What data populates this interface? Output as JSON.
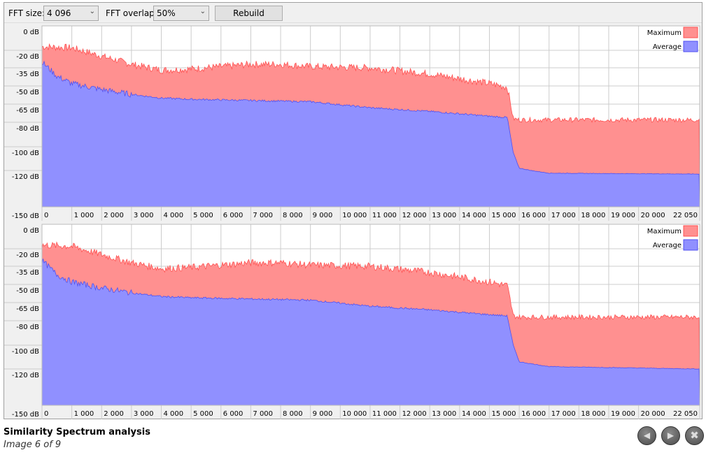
{
  "toolbar": {
    "fft_size_label": "FFT size:",
    "fft_size_value": "4 096",
    "fft_overlap_label": "FFT overlap:",
    "fft_overlap_value": "50%",
    "rebuild_label": "Rebuild"
  },
  "footer": {
    "title": "Similarity Spectrum analysis",
    "subtitle": "Image 6 of 9"
  },
  "icons": {
    "prev": "skip-previous-icon",
    "next": "skip-next-icon",
    "close": "close-icon"
  },
  "chart_data": [
    {
      "type": "area",
      "legend_position": "top-right",
      "grid": true,
      "y_ticks": [
        "0 dB",
        "-20 dB",
        "-35 dB",
        "-50 dB",
        "-65 dB",
        "-80 dB",
        "-100 dB",
        "-120 dB",
        "-150 dB"
      ],
      "y_tick_values": [
        0,
        -20,
        -35,
        -50,
        -65,
        -80,
        -100,
        -120,
        -150
      ],
      "x_ticks": [
        "0",
        "1 000",
        "2 000",
        "3 000",
        "4 000",
        "5 000",
        "6 000",
        "7 000",
        "8 000",
        "9 000",
        "10 000",
        "11 000",
        "12 000",
        "13 000",
        "14 000",
        "15 000",
        "16 000",
        "17 000",
        "18 000",
        "19 000",
        "20 000",
        "22 050"
      ],
      "x_tick_values": [
        0,
        1000,
        2000,
        3000,
        4000,
        5000,
        6000,
        7000,
        8000,
        9000,
        10000,
        11000,
        12000,
        13000,
        14000,
        15000,
        16000,
        17000,
        18000,
        19000,
        20000,
        22050
      ],
      "xlim": [
        0,
        22050
      ],
      "series": [
        {
          "name": "Maximum",
          "color": "#ff9090",
          "line": "#ff5050",
          "x": [
            0,
            1000,
            2000,
            3000,
            4000,
            5000,
            7000,
            8000,
            9000,
            11000,
            13000,
            15000,
            15600,
            15800,
            16000,
            22050
          ],
          "y": [
            -17,
            -18,
            -25,
            -32,
            -37,
            -36,
            -32,
            -32,
            -34,
            -35,
            -40,
            -48,
            -51,
            -77,
            -78,
            -78
          ]
        },
        {
          "name": "Average",
          "color": "#9090ff",
          "line": "#5050f0",
          "x": [
            0,
            500,
            1000,
            2000,
            3000,
            4000,
            5000,
            7000,
            9000,
            11000,
            13000,
            15000,
            15600,
            15800,
            16000,
            17000,
            22050
          ],
          "y": [
            -30,
            -42,
            -48,
            -53,
            -57,
            -60,
            -61,
            -62,
            -63,
            -68,
            -71,
            -75,
            -76,
            -105,
            -118,
            -123,
            -124
          ]
        }
      ]
    },
    {
      "type": "area",
      "legend_position": "top-right",
      "grid": true,
      "y_ticks": [
        "0 dB",
        "-20 dB",
        "-35 dB",
        "-50 dB",
        "-65 dB",
        "-80 dB",
        "-100 dB",
        "-120 dB",
        "-150 dB"
      ],
      "y_tick_values": [
        0,
        -20,
        -35,
        -50,
        -65,
        -80,
        -100,
        -120,
        -150
      ],
      "x_ticks": [
        "0",
        "1 000",
        "2 000",
        "3 000",
        "4 000",
        "5 000",
        "6 000",
        "7 000",
        "8 000",
        "9 000",
        "10 000",
        "11 000",
        "12 000",
        "13 000",
        "14 000",
        "15 000",
        "16 000",
        "17 000",
        "18 000",
        "19 000",
        "20 000",
        "22 050"
      ],
      "x_tick_values": [
        0,
        1000,
        2000,
        3000,
        4000,
        5000,
        6000,
        7000,
        8000,
        9000,
        10000,
        11000,
        12000,
        13000,
        14000,
        15000,
        16000,
        17000,
        18000,
        19000,
        20000,
        22050
      ],
      "xlim": [
        0,
        22050
      ],
      "series": [
        {
          "name": "Maximum",
          "color": "#ff9090",
          "line": "#ff5050",
          "x": [
            0,
            1000,
            2000,
            3000,
            4000,
            5000,
            7000,
            8000,
            9000,
            11000,
            13000,
            15000,
            15600,
            15800,
            16000,
            22050
          ],
          "y": [
            -17,
            -18,
            -25,
            -32,
            -37,
            -36,
            -32,
            -32,
            -34,
            -35,
            -40,
            -48,
            -51,
            -76,
            -77,
            -77
          ]
        },
        {
          "name": "Average",
          "color": "#9090ff",
          "line": "#5050f0",
          "x": [
            0,
            500,
            1000,
            2000,
            3000,
            4000,
            5000,
            7000,
            9000,
            11000,
            13000,
            15000,
            15600,
            15800,
            16000,
            17000,
            22050
          ],
          "y": [
            -30,
            -42,
            -48,
            -53,
            -57,
            -60,
            -61,
            -62,
            -63,
            -68,
            -71,
            -75,
            -76,
            -100,
            -114,
            -118,
            -120
          ]
        }
      ]
    }
  ]
}
